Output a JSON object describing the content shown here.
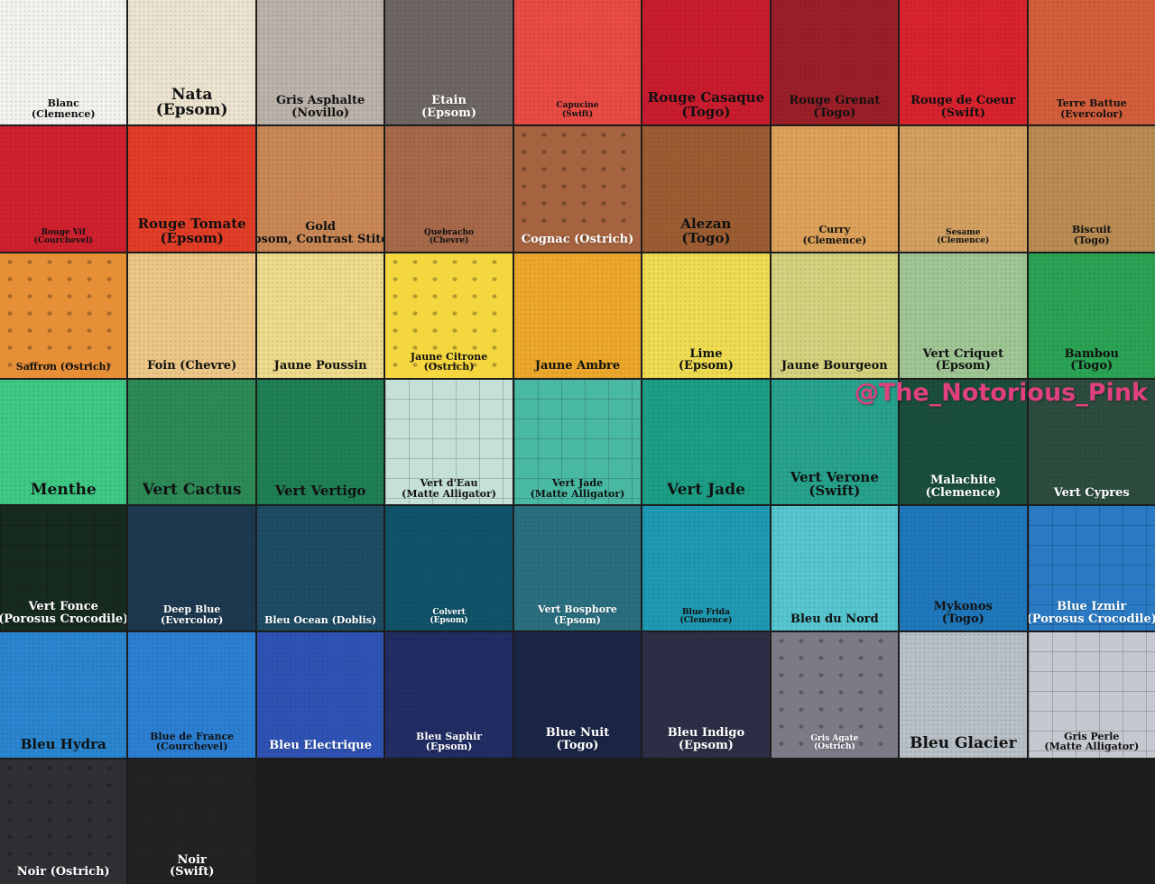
{
  "watermark": "@The_Notorious_Pink",
  "swatches": [
    {
      "name": "Blanc",
      "sub": "(Clemence)",
      "color": "#f3f2ef",
      "text": "dark",
      "size": "s",
      "texture": "grain"
    },
    {
      "name": "Nata",
      "sub": "(Epsom)",
      "color": "#ece4d0",
      "text": "dark",
      "size": "xl",
      "texture": "grain"
    },
    {
      "name": "Gris Asphalte",
      "sub": "(Novillo)",
      "color": "#bbb2aa",
      "text": "dark",
      "size": "m",
      "texture": "grain"
    },
    {
      "name": "Etain",
      "sub": "(Epsom)",
      "color": "#6d6663",
      "text": "light",
      "size": "m",
      "texture": "grain"
    },
    {
      "name": "Capucine",
      "sub": "(Swift)",
      "color": "#ea4b45",
      "text": "dark",
      "size": "xs",
      "texture": "grain"
    },
    {
      "name": "Rouge Casaque",
      "sub": "(Togo)",
      "color": "#c91c2e",
      "text": "dark",
      "size": "l",
      "texture": "grain"
    },
    {
      "name": "Rouge Grenat",
      "sub": "(Togo)",
      "color": "#9b1f28",
      "text": "dark",
      "size": "m",
      "texture": "grain"
    },
    {
      "name": "Rouge de Coeur",
      "sub": "(Swift)",
      "color": "#d9232f",
      "text": "dark",
      "size": "m",
      "texture": "grain"
    },
    {
      "name": "Terre Battue",
      "sub": "(Evercolor)",
      "color": "#d45e3b",
      "text": "dark",
      "size": "s",
      "texture": "grain"
    },
    {
      "name": "Rouge Vif",
      "sub": "(Courchevel)",
      "color": "#d0212f",
      "text": "dark",
      "size": "xs",
      "texture": "grain"
    },
    {
      "name": "Rouge Tomate",
      "sub": "(Epsom)",
      "color": "#e23d27",
      "text": "dark",
      "size": "l",
      "texture": "grain"
    },
    {
      "name": "Gold",
      "sub": "(Epsom, Contrast Stitch)",
      "color": "#c98856",
      "text": "dark",
      "size": "m",
      "texture": "grain"
    },
    {
      "name": "Quebracho",
      "sub": "(Chevre)",
      "color": "#a7694a",
      "text": "dark",
      "size": "xs",
      "texture": "grain"
    },
    {
      "name": "Cognac (Ostrich)",
      "sub": "",
      "color": "#a5633f",
      "text": "light",
      "size": "m",
      "texture": "ostrich"
    },
    {
      "name": "Alezan",
      "sub": "(Togo)",
      "color": "#9d5d33",
      "text": "dark",
      "size": "l",
      "texture": "grain"
    },
    {
      "name": "Curry",
      "sub": "(Clemence)",
      "color": "#dda25a",
      "text": "dark",
      "size": "s",
      "texture": "grain"
    },
    {
      "name": "Sesame",
      "sub": "(Clemence)",
      "color": "#d3a061",
      "text": "dark",
      "size": "xs",
      "texture": "grain"
    },
    {
      "name": "Biscuit",
      "sub": "(Togo)",
      "color": "#b98c53",
      "text": "dark",
      "size": "s",
      "texture": "grain"
    },
    {
      "name": "Saffron (Ostrich)",
      "sub": "",
      "color": "#e78f37",
      "text": "dark",
      "size": "s",
      "texture": "ostrich"
    },
    {
      "name": "Foin (Chevre)",
      "sub": "",
      "color": "#ecc787",
      "text": "dark",
      "size": "m",
      "texture": "grain"
    },
    {
      "name": "Jaune Poussin",
      "sub": "",
      "color": "#efdb8c",
      "text": "dark",
      "size": "m",
      "texture": "grain"
    },
    {
      "name": "Jaune Citrone",
      "sub": "(Ostrich)",
      "color": "#f4d63f",
      "text": "dark",
      "size": "s",
      "texture": "ostrich"
    },
    {
      "name": "Jaune Ambre",
      "sub": "",
      "color": "#eda82b",
      "text": "dark",
      "size": "m",
      "texture": "grain"
    },
    {
      "name": "Lime",
      "sub": "(Epsom)",
      "color": "#efdc52",
      "text": "dark",
      "size": "m",
      "texture": "grain"
    },
    {
      "name": "Jaune Bourgeon",
      "sub": "",
      "color": "#d4d27e",
      "text": "dark",
      "size": "m",
      "texture": "grain"
    },
    {
      "name": "Vert Criquet",
      "sub": "(Epsom)",
      "color": "#9fc694",
      "text": "dark",
      "size": "m",
      "texture": "grain"
    },
    {
      "name": "Bambou",
      "sub": "(Togo)",
      "color": "#2aa354",
      "text": "dark",
      "size": "m",
      "texture": "grain"
    },
    {
      "name": "Menthe",
      "sub": "",
      "color": "#3ec985",
      "text": "dark",
      "size": "xl",
      "texture": "grain"
    },
    {
      "name": "Vert Cactus",
      "sub": "",
      "color": "#2d8b57",
      "text": "dark",
      "size": "xl",
      "texture": "grain"
    },
    {
      "name": "Vert Vertigo",
      "sub": "",
      "color": "#1f7f55",
      "text": "dark",
      "size": "l",
      "texture": "grain"
    },
    {
      "name": "Vert d'Eau",
      "sub": "(Matte Alligator)",
      "color": "#c5e0d4",
      "text": "dark",
      "size": "s",
      "texture": "croc"
    },
    {
      "name": "Vert Jade",
      "sub": "(Matte Alligator)",
      "color": "#4ab9a4",
      "text": "dark",
      "size": "s",
      "texture": "croc"
    },
    {
      "name": "Vert Jade",
      "sub": "",
      "color": "#1c9f85",
      "text": "dark",
      "size": "xl",
      "texture": "grain"
    },
    {
      "name": "Vert Verone",
      "sub": "(Swift)",
      "color": "#27a28c",
      "text": "dark",
      "size": "l",
      "texture": "grain"
    },
    {
      "name": "Malachite",
      "sub": "(Clemence)",
      "color": "#1b4f3c",
      "text": "light",
      "size": "m",
      "texture": "grain"
    },
    {
      "name": "Vert Cypres",
      "sub": "",
      "color": "#2d4d3f",
      "text": "light",
      "size": "m",
      "texture": "grain"
    },
    {
      "name": "Vert Fonce",
      "sub": "(Porosus Crocodile)",
      "color": "#172a20",
      "text": "light",
      "size": "m",
      "texture": "croc"
    },
    {
      "name": "Deep Blue",
      "sub": "(Evercolor)",
      "color": "#1d3950",
      "text": "light",
      "size": "s",
      "texture": "grain"
    },
    {
      "name": "Bleu Ocean (Doblis)",
      "sub": "",
      "color": "#1d4c64",
      "text": "light",
      "size": "s",
      "texture": "grain"
    },
    {
      "name": "Colvert",
      "sub": "(Epsom)",
      "color": "#11546a",
      "text": "light",
      "size": "xs",
      "texture": "grain"
    },
    {
      "name": "Vert Bosphore",
      "sub": "(Epsom)",
      "color": "#2a6f80",
      "text": "light",
      "size": "s",
      "texture": "grain"
    },
    {
      "name": "Blue Frida",
      "sub": "(Clemence)",
      "color": "#1f9ab4",
      "text": "dark",
      "size": "xs",
      "texture": "grain"
    },
    {
      "name": "Bleu du Nord",
      "sub": "",
      "color": "#56c6d0",
      "text": "dark",
      "size": "m",
      "texture": "grain"
    },
    {
      "name": "Mykonos",
      "sub": "(Togo)",
      "color": "#1f78bb",
      "text": "dark",
      "size": "m",
      "texture": "grain"
    },
    {
      "name": "Blue Izmir",
      "sub": "(Porosus Crocodile)",
      "color": "#2a7ac3",
      "text": "light",
      "size": "m",
      "texture": "croc"
    },
    {
      "name": "Bleu Hydra",
      "sub": "",
      "color": "#2a86cf",
      "text": "dark",
      "size": "l",
      "texture": "grain"
    },
    {
      "name": "Blue de France",
      "sub": "(Courchevel)",
      "color": "#2c80d4",
      "text": "dark",
      "size": "s",
      "texture": "grain"
    },
    {
      "name": "Bleu Electrique",
      "sub": "",
      "color": "#2f53b5",
      "text": "light",
      "size": "m",
      "texture": "grain"
    },
    {
      "name": "Bleu Saphir",
      "sub": "(Epsom)",
      "color": "#212d64",
      "text": "light",
      "size": "s",
      "texture": "grain"
    },
    {
      "name": "Blue Nuit",
      "sub": "(Togo)",
      "color": "#1b2647",
      "text": "light",
      "size": "m",
      "texture": "grain"
    },
    {
      "name": "Bleu Indigo",
      "sub": "(Epsom)",
      "color": "#2d2f46",
      "text": "light",
      "size": "m",
      "texture": "grain"
    },
    {
      "name": "Gris Agate",
      "sub": "(Ostrich)",
      "color": "#7a7b86",
      "text": "light",
      "size": "xs",
      "texture": "ostrich"
    },
    {
      "name": "Bleu Glacier",
      "sub": "",
      "color": "#b8c1c7",
      "text": "dark",
      "size": "xl",
      "texture": "grain"
    },
    {
      "name": "Gris Perle",
      "sub": "(Matte Alligator)",
      "color": "#c6c8d0",
      "text": "dark",
      "size": "s",
      "texture": "croc"
    },
    {
      "name": "Noir (Ostrich)",
      "sub": "",
      "color": "#2f3033",
      "text": "light",
      "size": "m",
      "texture": "ostrich"
    },
    {
      "name": "Noir",
      "sub": "(Swift)",
      "color": "#232325",
      "text": "light",
      "size": "m",
      "texture": "grain"
    }
  ]
}
